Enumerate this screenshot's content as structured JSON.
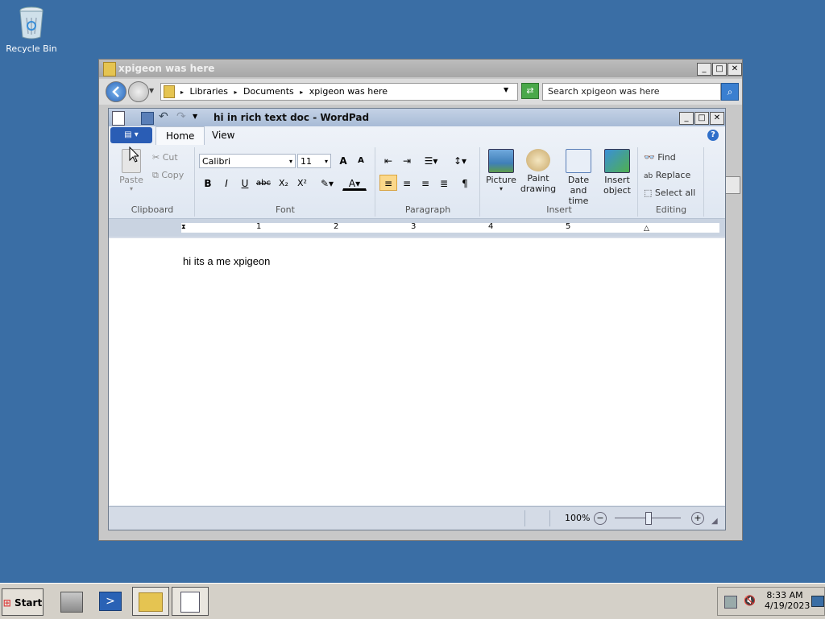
{
  "desktop": {
    "recycle_bin_label": "Recycle Bin"
  },
  "explorer": {
    "title": "xpigeon was here",
    "breadcrumb": [
      "Libraries",
      "Documents",
      "xpigeon was here"
    ],
    "search_placeholder": "Search xpigeon was here"
  },
  "wordpad": {
    "title": "hi in rich text doc - WordPad",
    "tabs": {
      "home": "Home",
      "view": "View"
    },
    "clipboard": {
      "paste": "Paste",
      "cut": "Cut",
      "copy": "Copy",
      "group": "Clipboard"
    },
    "font": {
      "family": "Calibri",
      "size": "11",
      "group": "Font"
    },
    "paragraph": {
      "group": "Paragraph"
    },
    "insert": {
      "picture": "Picture",
      "paint1": "Paint",
      "paint2": "drawing",
      "date1": "Date and",
      "date2": "time",
      "obj1": "Insert",
      "obj2": "object",
      "group": "Insert"
    },
    "editing": {
      "find": "Find",
      "replace": "Replace",
      "select_all": "Select all",
      "group": "Editing"
    },
    "ruler_numbers": [
      "1",
      "2",
      "3",
      "4",
      "5"
    ],
    "document_text": "hi its a me xpigeon",
    "zoom": "100%"
  },
  "taskbar": {
    "start": "Start",
    "time": "8:33 AM",
    "date": "4/19/2023"
  },
  "colors": {
    "desktop": "#3a6ea5",
    "accent": "#2a5db5"
  }
}
